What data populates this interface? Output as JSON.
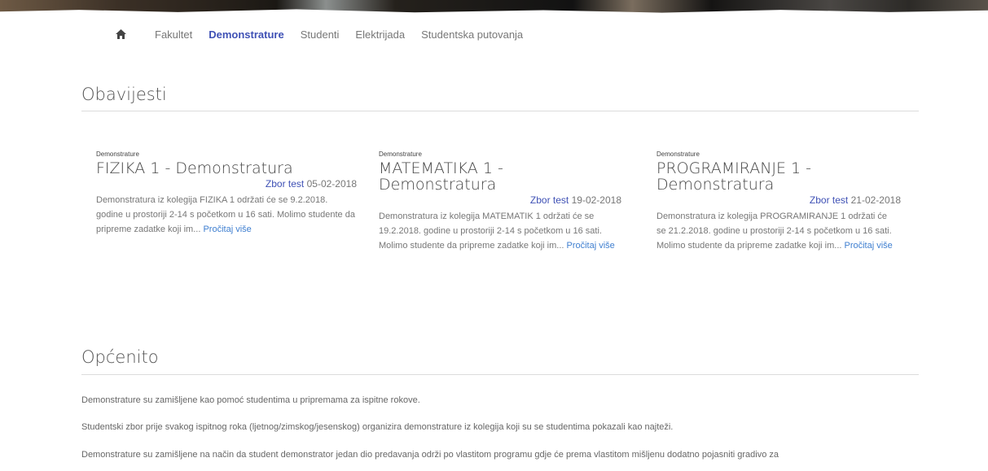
{
  "nav": {
    "home_icon": "home-icon",
    "items": [
      {
        "label": "Fakultet",
        "active": false
      },
      {
        "label": "Demonstrature",
        "active": true
      },
      {
        "label": "Studenti",
        "active": false
      },
      {
        "label": "Elektrijada",
        "active": false
      },
      {
        "label": "Studentska putovanja",
        "active": false
      }
    ]
  },
  "obavijesti": {
    "heading": "Obavijesti",
    "cards": [
      {
        "category": "Demonstrature",
        "title": "FIZIKA 1 - Demonstratura",
        "author": "Zbor test",
        "date": "05-02-2018",
        "excerpt": "Demonstratura iz kolegija FIZIKA 1 održati će se 9.2.2018. godine u prostoriji 2-14 s početkom u 16 sati. Molimo studente da pripreme zadatke koji im...",
        "more": "Pročitaj više"
      },
      {
        "category": "Demonstrature",
        "title": "MATEMATIKA 1 - Demonstratura",
        "author": "Zbor test",
        "date": "19-02-2018",
        "excerpt": "Demonstratura iz kolegija MATEMATIK 1 održati će se 19.2.2018. godine u prostoriji 2-14 s početkom u 16 sati. Molimo studente da pripreme zadatke koji im...",
        "more": "Pročitaj više"
      },
      {
        "category": "Demonstrature",
        "title": "PROGRAMIRANJE 1 - Demonstratura",
        "author": "Zbor test",
        "date": "21-02-2018",
        "excerpt": "Demonstratura iz kolegija PROGRAMIRANJE 1 održati će se 21.2.2018. godine u prostoriji 2-14 s početkom u 16 sati. Molimo studente da pripreme zadatke koji im...",
        "more": "Pročitaj više"
      }
    ]
  },
  "opcenito": {
    "heading": "Općenito",
    "paragraphs": [
      "Demonstrature su zamišljene kao pomoć studentima u pripremama za ispitne rokove.",
      "Studentski zbor prije svakog ispitnog roka (ljetnog/zimskog/jesenskog) organizira demonstrature iz kolegija koji su se studentima pokazali kao najteži.",
      "Demonstrature su zamišljene na način da student demonstrator jedan dio predavanja održi po vlastitom programu gdje će prema vlastitom mišljenu dodatno pojasniti gradivo za"
    ]
  }
}
